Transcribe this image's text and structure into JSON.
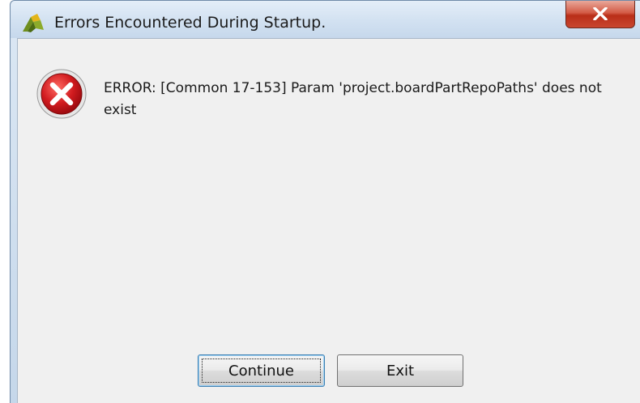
{
  "window": {
    "title": "Errors Encountered During Startup.",
    "close_glyph": "X"
  },
  "message": {
    "text": "ERROR: [Common 17-153] Param 'project.boardPartRepoPaths' does not exist"
  },
  "buttons": {
    "continue_label": "Continue",
    "exit_label": "Exit"
  },
  "icons": {
    "app": "app-logo-icon",
    "error": "error-icon",
    "close": "close-icon"
  },
  "colors": {
    "error_red": "#c8141a",
    "close_red": "#c9462f",
    "dialog_bg": "#f0f0f0"
  }
}
